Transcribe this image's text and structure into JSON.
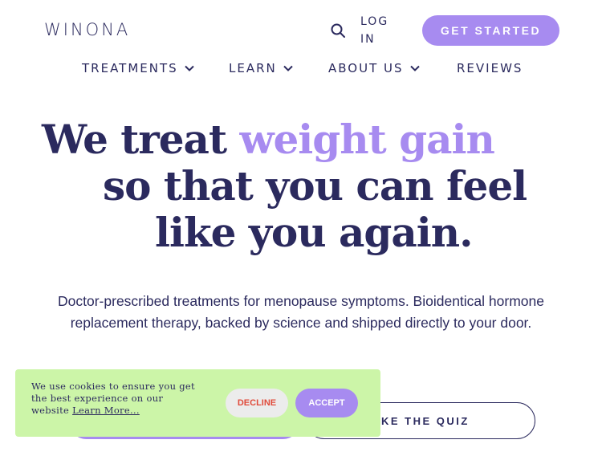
{
  "header": {
    "logo": "WINONA",
    "search_icon": "search-icon",
    "login_label": "LOG IN",
    "cta_label": "GET STARTED"
  },
  "nav": {
    "items": [
      {
        "label": "TREATMENTS",
        "has_dropdown": true
      },
      {
        "label": "LEARN",
        "has_dropdown": true
      },
      {
        "label": "ABOUT US",
        "has_dropdown": true
      },
      {
        "label": "REVIEWS",
        "has_dropdown": false
      }
    ]
  },
  "hero": {
    "line1_prefix": "We treat ",
    "line1_accent": "weight gain",
    "line2": "so that you can feel",
    "line3": "like you again."
  },
  "description": "Doctor-prescribed treatments for menopause symptoms. Bioidentical hormone replacement therapy, backed by science and shipped directly to your door.",
  "buttons": {
    "quiz_label": "AKE THE QUIZ"
  },
  "cookie": {
    "text": "We use cookies to ensure you get the best experience on our website",
    "link_label": "Learn More...",
    "decline_label": "DECLINE",
    "accept_label": "ACCEPT"
  },
  "colors": {
    "brand_navy": "#2b2a5e",
    "accent_purple": "#a78bf0",
    "cookie_green": "#ccf5a8",
    "decline_red": "#e04a3a"
  }
}
